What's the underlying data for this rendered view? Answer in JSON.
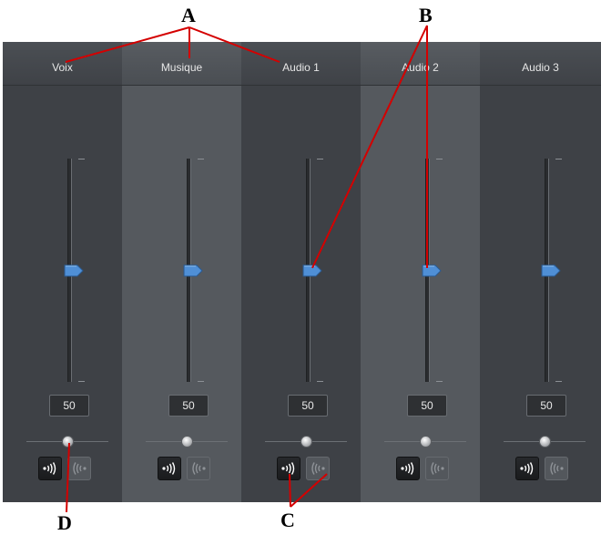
{
  "channels": [
    {
      "name": "Voix",
      "value": "50",
      "volume_level": 0.5,
      "pan_level": 0.5
    },
    {
      "name": "Musique",
      "value": "50",
      "volume_level": 0.5,
      "pan_level": 0.5
    },
    {
      "name": "Audio 1",
      "value": "50",
      "volume_level": 0.5,
      "pan_level": 0.5
    },
    {
      "name": "Audio 2",
      "value": "50",
      "volume_level": 0.5,
      "pan_level": 0.5
    },
    {
      "name": "Audio 3",
      "value": "50",
      "volume_level": 0.5,
      "pan_level": 0.5
    }
  ],
  "icons": {
    "solo": "speaker-waves-out-icon",
    "mute": "speaker-waves-in-icon"
  },
  "annotations": {
    "a": "A",
    "b": "B",
    "c": "C",
    "d": "D"
  },
  "colors": {
    "thumb": "#4f8fd6",
    "annotation": "#d40000"
  }
}
